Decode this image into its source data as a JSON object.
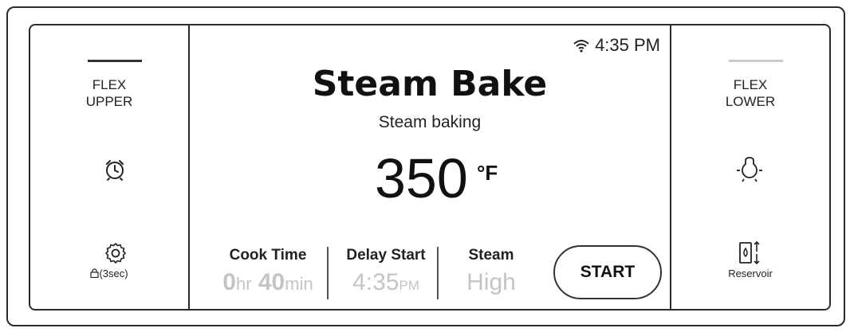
{
  "colors": {
    "frame": "#2b2b2b",
    "indicator_active": "#333333",
    "indicator_inactive": "#cccccc",
    "muted_value": "#c4c4c4"
  },
  "left_panel": {
    "label_line1": "FLEX",
    "label_line2": "UPPER",
    "timer_icon": "alarm-clock-icon",
    "settings_icon": "gear-icon",
    "lock_label": "(3sec)",
    "lock_icon": "lock-icon"
  },
  "right_panel": {
    "label_line1": "FLEX",
    "label_line2": "LOWER",
    "light_icon": "oven-light-icon",
    "reservoir_icon": "water-reservoir-icon",
    "reservoir_label": "Reservoir"
  },
  "status_bar": {
    "wifi_icon": "wifi-icon",
    "time": "4:35 PM"
  },
  "main": {
    "mode_title": "Steam Bake",
    "mode_subtitle": "Steam baking",
    "temperature": "350",
    "temperature_unit": "°F"
  },
  "settings": {
    "cook_time": {
      "label": "Cook Time",
      "hours": "0",
      "hours_unit": "hr",
      "minutes": "40",
      "minutes_unit": "min"
    },
    "delay_start": {
      "label": "Delay Start",
      "time": "4:35",
      "ampm": "PM"
    },
    "steam": {
      "label": "Steam",
      "value": "High"
    }
  },
  "start_button": {
    "label": "START"
  }
}
